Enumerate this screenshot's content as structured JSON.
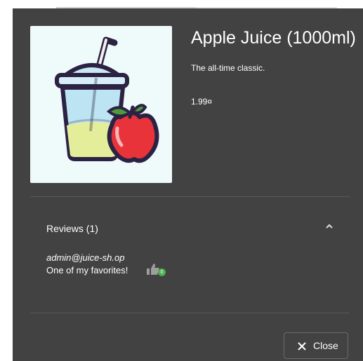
{
  "product": {
    "title": "Apple Juice (1000ml)",
    "description": "The all-time classic.",
    "price": "1.99¤",
    "image_icon": "apple-juice-cup-icon"
  },
  "reviews": {
    "header": "Reviews (1)",
    "expanded": true,
    "items": [
      {
        "author": "admin@juice-sh.op",
        "text": "One of my favorites!",
        "likes": "0"
      }
    ]
  },
  "actions": {
    "close_label": "Close"
  },
  "colors": {
    "dialog_bg": "#424242",
    "image_bg": "#effafb",
    "like_badge": "#4caf50"
  }
}
